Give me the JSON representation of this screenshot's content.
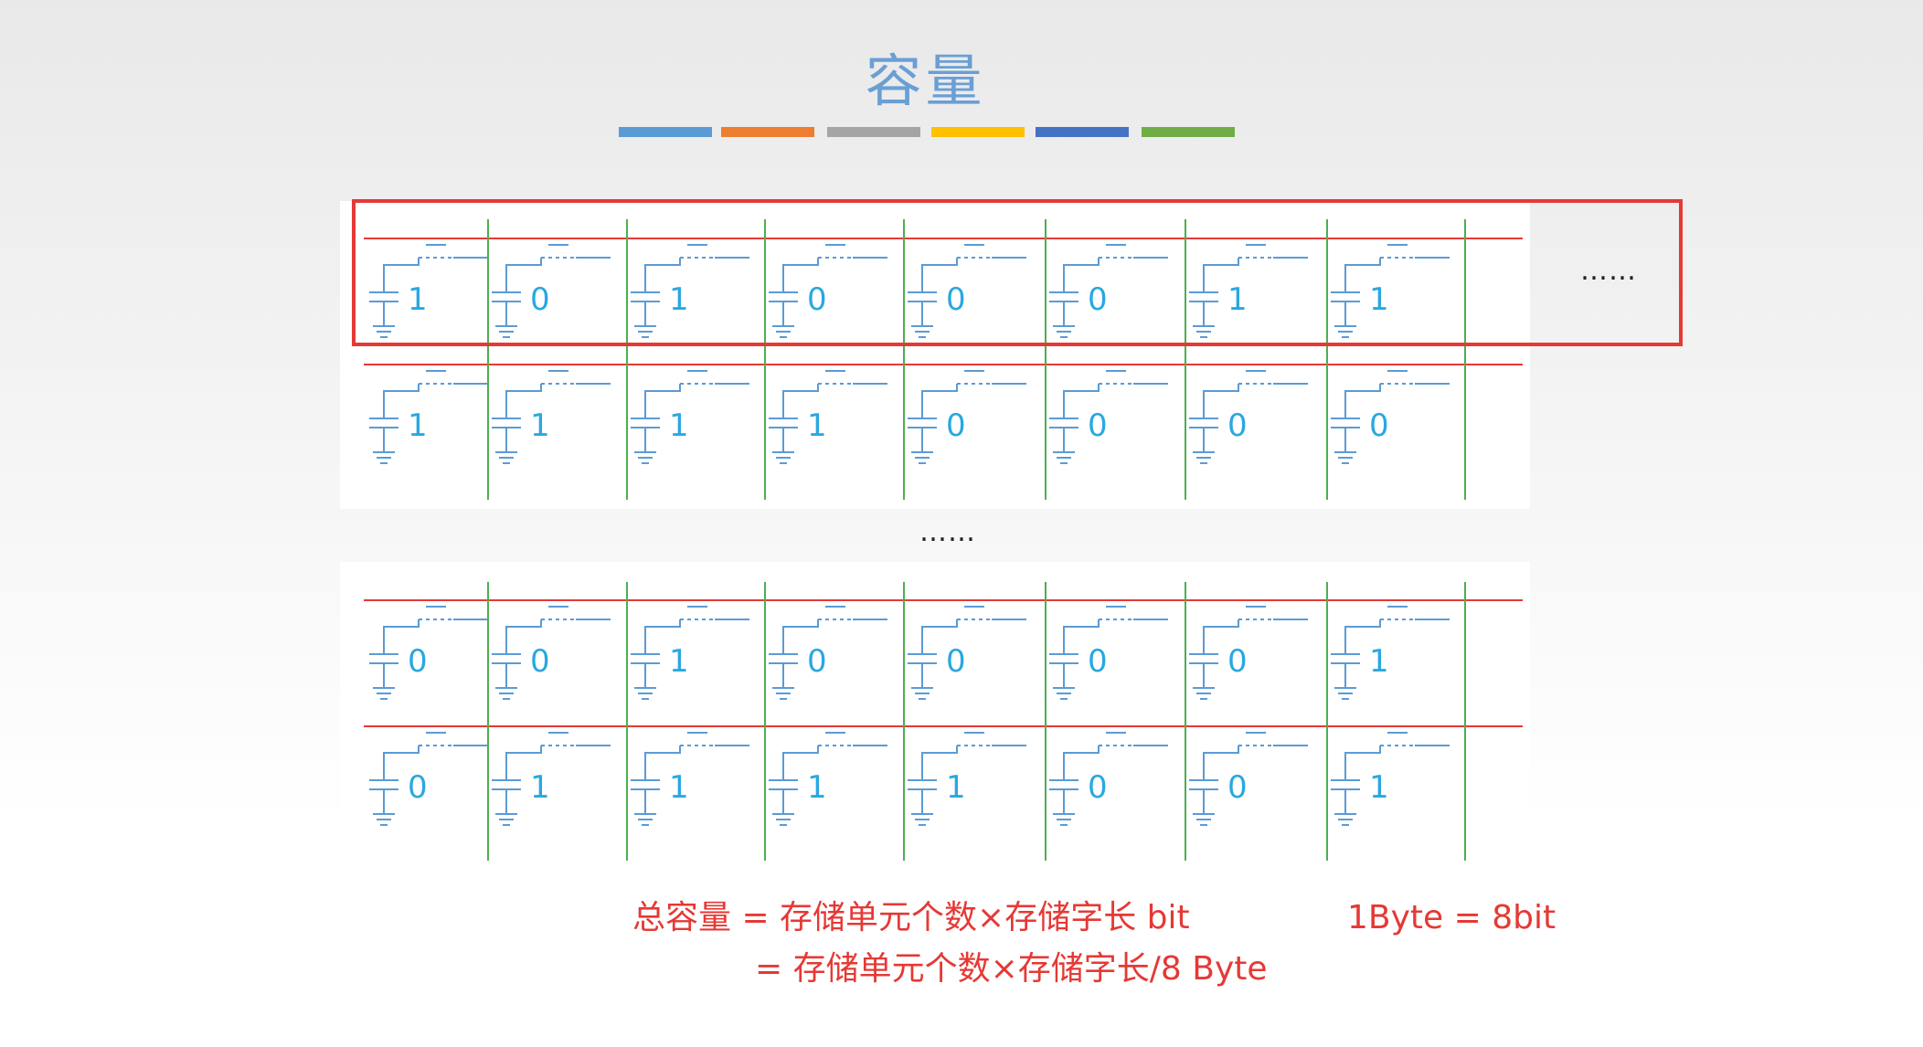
{
  "title": "容量",
  "color_bars": [
    "#5b9bd5",
    "#ed7d31",
    "#a5a5a5",
    "#ffc000",
    "#4472c4",
    "#70ad47"
  ],
  "colors": {
    "circuit": "#5b9bd5",
    "bit_text": "#29a8e0",
    "word_line": "#e53935",
    "bit_line": "#4caf50",
    "highlight": "#e53935"
  },
  "top_array": {
    "rows": [
      [
        "1",
        "0",
        "1",
        "0",
        "0",
        "0",
        "1",
        "1"
      ],
      [
        "1",
        "1",
        "1",
        "1",
        "0",
        "0",
        "0",
        "0"
      ]
    ]
  },
  "bottom_array": {
    "rows": [
      [
        "0",
        "0",
        "1",
        "0",
        "0",
        "0",
        "0",
        "1"
      ],
      [
        "0",
        "1",
        "1",
        "1",
        "1",
        "0",
        "0",
        "1"
      ]
    ]
  },
  "row_ellipsis": "……",
  "middle_ellipsis": "……",
  "formula": {
    "line1": "总容量 = 存储单元个数×存储字长  bit",
    "line2": "= 存储单元个数×存储字长/8  Byte",
    "conversion": "1Byte = 8bit"
  }
}
